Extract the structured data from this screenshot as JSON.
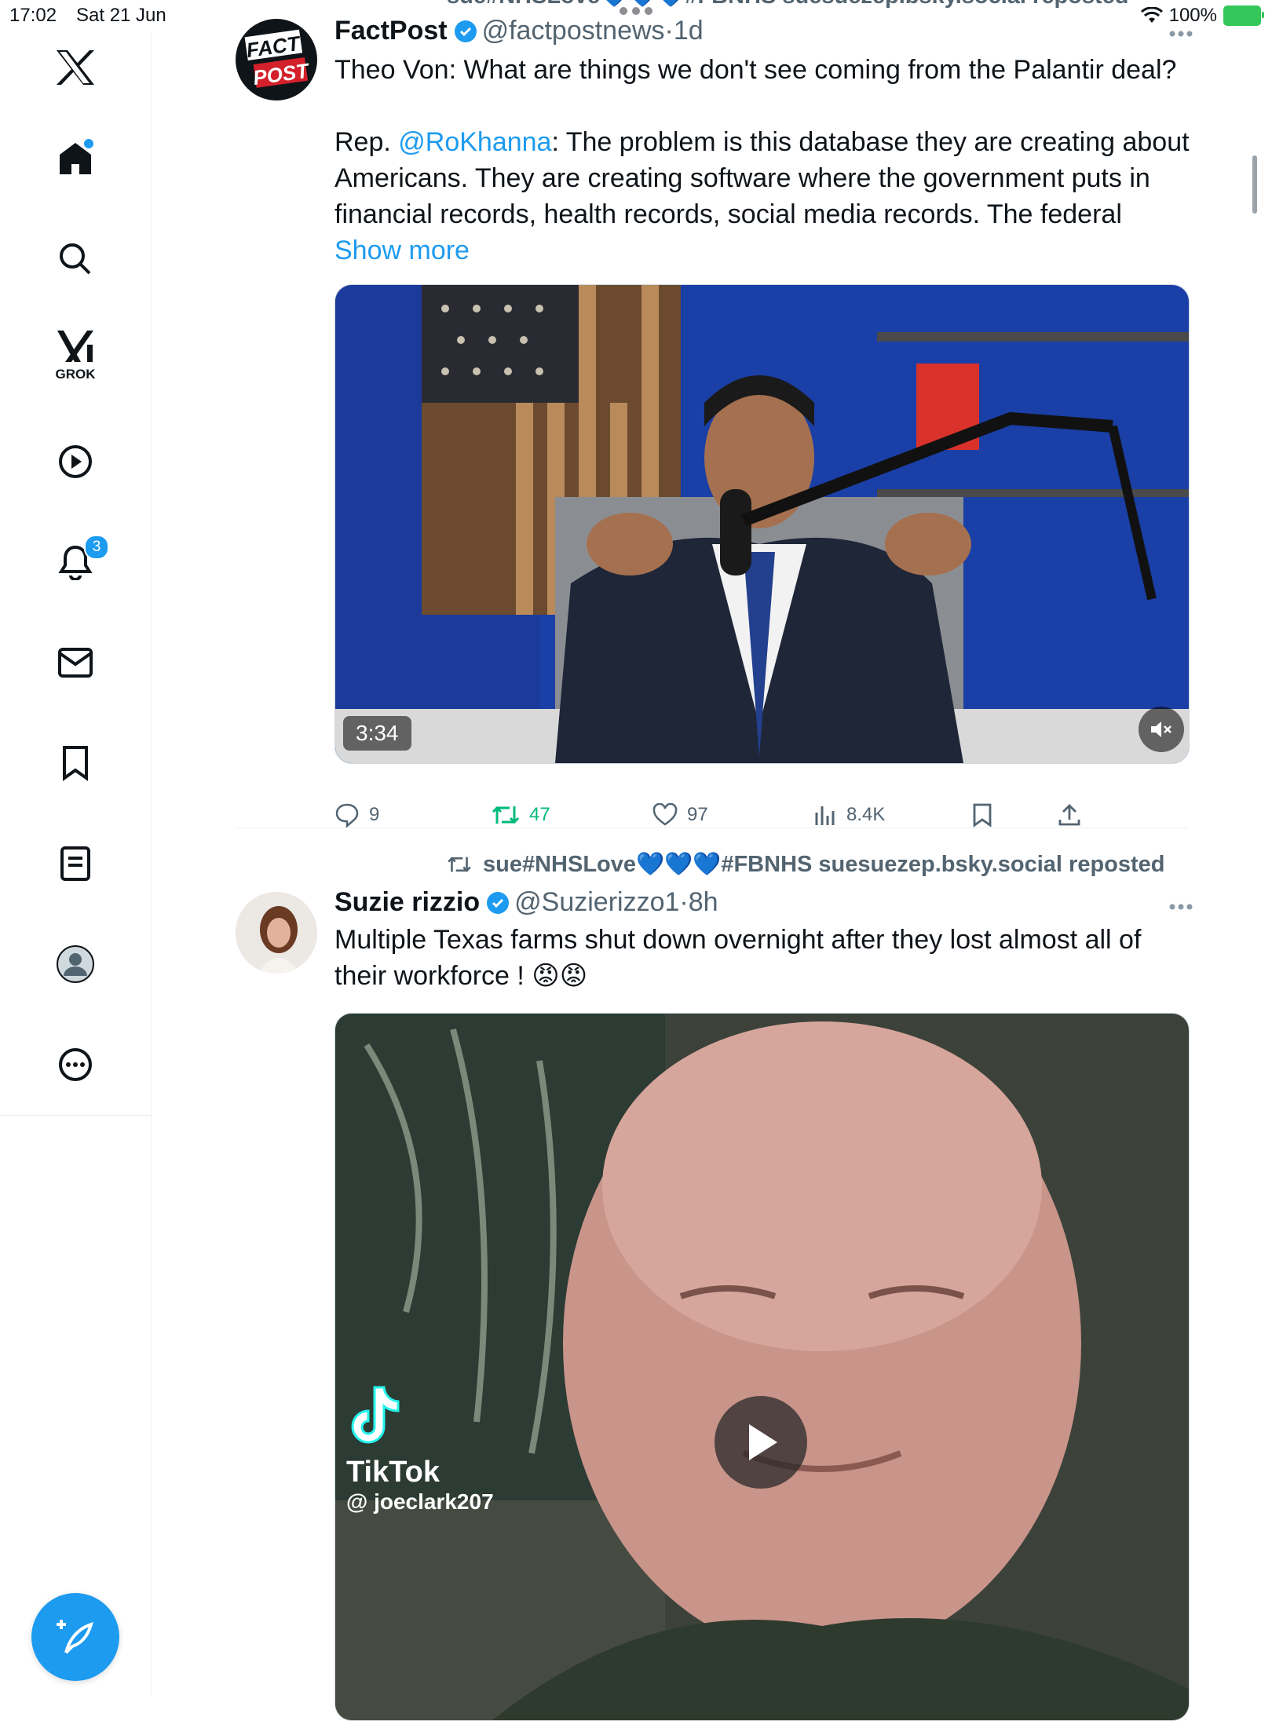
{
  "status_bar": {
    "time": "17:02",
    "date": "Sat 21 Jun",
    "battery": "100%"
  },
  "sidebar": {
    "grok_label": "GROK",
    "notifications_badge": "3",
    "items": [
      "home",
      "search",
      "grok",
      "videos",
      "notifications",
      "messages",
      "bookmarks",
      "lists",
      "profile",
      "more"
    ]
  },
  "feed": {
    "partial_repost_line": "sue#NHSLove💙💙💙#FBNHS suesuezep.bsky.social reposted",
    "tweets": [
      {
        "name": "FactPost",
        "handle": "@factpostnews",
        "sep": "·",
        "time": "1d",
        "avatar_text_1": "FACT",
        "avatar_text_2": "POST",
        "line1": "Theo Von: What are things we don't see coming from the Palantir deal?",
        "line2_prefix": "Rep. ",
        "mention": "@RoKhanna",
        "line2_rest": ": The problem is this database they are creating about Americans. They are creating software where the government puts in financial records, health records, social media records. The federal ",
        "show_more": "Show more",
        "video_duration": "3:34",
        "stats": {
          "replies": "9",
          "reposts": "47",
          "likes": "97",
          "views": "8.4K"
        }
      },
      {
        "repost_label": "sue#NHSLove💙💙💙#FBNHS suesuezep.bsky.social reposted",
        "name": "Suzie rizzio",
        "handle": "@Suzierizzo1",
        "sep": "·",
        "time": "8h",
        "text": "Multiple Texas farms  shut down overnight after they lost almost all of their workforce ! 😡😡",
        "tiktok_brand": "TikTok",
        "tiktok_user": "@ joeclark207"
      }
    ]
  },
  "colors": {
    "accent": "#1d9bf0",
    "repost_green": "#00ba7c",
    "muted": "#536471"
  }
}
